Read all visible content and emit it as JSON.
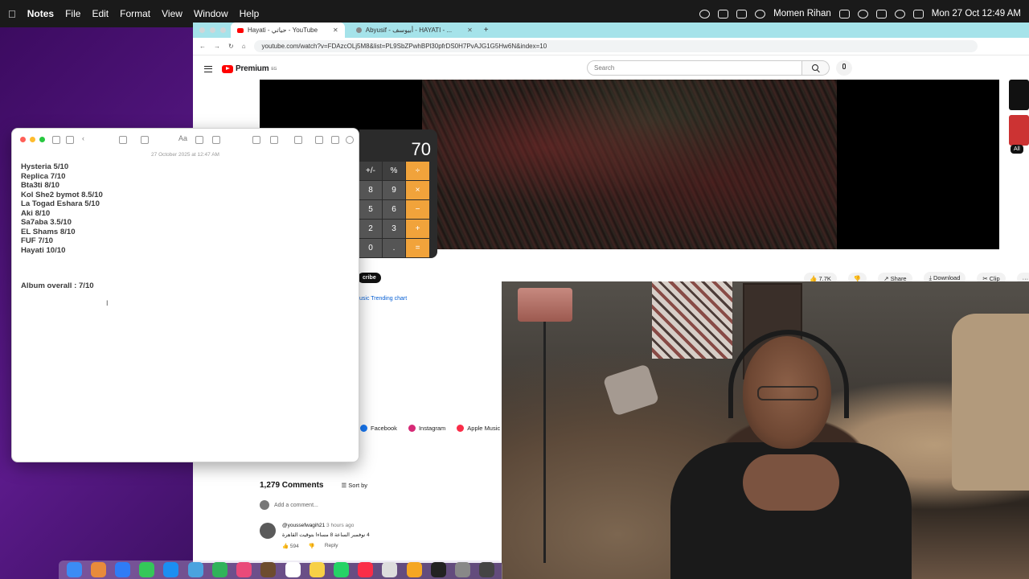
{
  "menubar": {
    "app": "Notes",
    "items": [
      "File",
      "Edit",
      "Format",
      "View",
      "Window",
      "Help"
    ],
    "user": "Momen Rihan",
    "datetime": "Mon 27 Oct  12:49 AM"
  },
  "browser": {
    "tabs": [
      {
        "label": "Hayati - حياتي - YouTube",
        "active": true
      },
      {
        "label": "Abyusif - أبيوسف - HAYATI - ...",
        "active": false
      }
    ],
    "url": "youtube.com/watch?v=FDAzcOLj5M8&list=PL9SbZPwhBPl30pfrDS0H7PvAJG1G5Hw6N&index=10"
  },
  "youtube": {
    "logo": "Premium",
    "logo_region": "EG",
    "search_placeholder": "Search",
    "subscribe_label": "cribe",
    "trending_link": "usic Trending chart",
    "likes": "7.7K",
    "share_label": "Share",
    "download_label": "Download",
    "clip_label": "Clip",
    "more_label": "···",
    "all_chip": "All",
    "social": [
      "Facebook",
      "Instagram",
      "Apple Music"
    ],
    "comments_count": "1,279 Comments",
    "sort_label": "Sort by",
    "add_comment_placeholder": "Add a comment...",
    "comment": {
      "author": "@youssefwagih21",
      "time": "3 hours ago",
      "text": "4 نوفمبر الساعة 8 مساءا بتوقيت القاهرة",
      "likes": "594",
      "reply": "Reply"
    }
  },
  "notes": {
    "date": "27 October 2025 at 12:47 AM",
    "lines": [
      "Hysteria 5/10",
      "Replica 7/10",
      "Bta3ti 8/10",
      "Kol She2 bymot 8.5/10",
      "La Togad Eshara 5/10",
      "Aki 8/10",
      "Sa7aba 3.5/10",
      "EL Shams 8/10",
      "FUF 7/10",
      "Hayati 10/10"
    ],
    "overall": "Album overall :  7/10",
    "font_label": "Aa"
  },
  "calculator": {
    "display": "70",
    "rows": [
      [
        "+/-",
        "%",
        "÷"
      ],
      [
        "8",
        "9",
        "×"
      ],
      [
        "5",
        "6",
        "−"
      ],
      [
        "2",
        "3",
        "+"
      ],
      [
        "0",
        ".",
        "="
      ]
    ]
  },
  "colors": {
    "youtube_red": "#ff0000",
    "calc_operator": "#f1a33b",
    "tab_bar": "#a5e3ea",
    "link_blue": "#065fd4"
  }
}
